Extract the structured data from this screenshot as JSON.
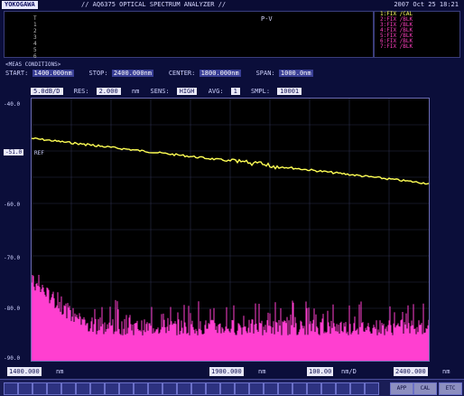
{
  "header": {
    "brand": "YOKOGAWA",
    "title": "// AQ6375 OPTICAL SPECTRUM ANALYZER //",
    "datetime": "2007 Oct 25 18:21"
  },
  "marker_panel": {
    "label": "P-V",
    "rows": [
      "T",
      "1",
      "2",
      "3",
      "4",
      "5",
      "6"
    ]
  },
  "trace_panel": {
    "rows": [
      "1:FIX /CAL",
      "2:FIX /BLK",
      "3:FIX /BLK",
      "4:FIX /BLK",
      "5:FIX /BLK",
      "6:FIX /BLK",
      "7:FIX /BLK"
    ]
  },
  "conditions": {
    "heading": "<MEAS CONDITIONS>",
    "start_label": "START:",
    "start": "1400.000nm",
    "stop_label": "STOP:",
    "stop": "2400.000nm",
    "center_label": "CENTER:",
    "center": "1800.000nm",
    "span_label": "SPAN:",
    "span": "1000.0nm"
  },
  "params": {
    "scale": "5.0dB/D",
    "res_label": "RES:",
    "res": "2.000",
    "res_unit": "nm",
    "sens_label": "SENS:",
    "sens": "HIGH",
    "avg_label": "AVG:",
    "avg": "1",
    "smpl_label": "SMPL:",
    "smpl": "10001"
  },
  "plot": {
    "y_labels": [
      "-40.0",
      "-50.0",
      "-60.0",
      "-70.0",
      "-80.0",
      "-90.0"
    ],
    "ref_label": "-51.0",
    "ref_text": "REF",
    "trace_color": "#ffff55",
    "noise_color": "#ff3fd0"
  },
  "bottom": {
    "left_val": "1400.000",
    "left_unit": "nm",
    "center_val": "1900.000",
    "center_unit": "nm",
    "perdiv_val": "100.00",
    "perdiv_unit": "nm/D",
    "right_val": "2400.000",
    "right_unit": "nm"
  },
  "toolbar": {
    "app1": "APP",
    "app2": "CAL",
    "app3": "ETC"
  }
}
